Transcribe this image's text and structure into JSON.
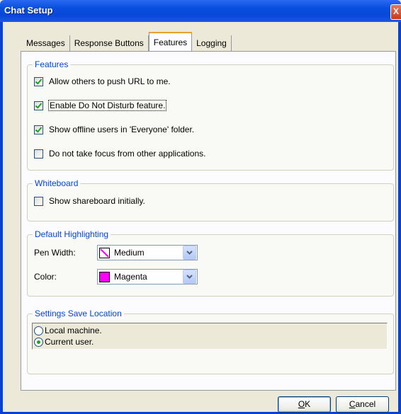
{
  "window": {
    "title": "Chat Setup",
    "close_glyph": "X"
  },
  "tabs": [
    {
      "label": "Messages"
    },
    {
      "label": "Response Buttons"
    },
    {
      "label": "Features",
      "active": true
    },
    {
      "label": "Logging"
    }
  ],
  "features": {
    "legend": "Features",
    "items": [
      {
        "label": "Allow others to push URL to me.",
        "checked": true
      },
      {
        "label": "Enable Do Not Disturb feature.",
        "checked": true
      },
      {
        "label": "Show offline users in 'Everyone' folder.",
        "checked": true
      },
      {
        "label": "Do not take focus from other applications.",
        "checked": false
      }
    ]
  },
  "whiteboard": {
    "legend": "Whiteboard",
    "items": [
      {
        "label": "Show shareboard initially.",
        "checked": false
      }
    ]
  },
  "highlighting": {
    "legend": "Default Highlighting",
    "pen_width_label": "Pen Width:",
    "pen_width_value": "Medium",
    "color_label": "Color:",
    "color_value": "Magenta",
    "color_hex": "#ff00ff"
  },
  "save_location": {
    "legend": "Settings Save Location",
    "options": [
      {
        "label": "Local machine.",
        "selected": false
      },
      {
        "label": "Current user.",
        "selected": true
      }
    ]
  },
  "buttons": {
    "ok_mnemonic": "O",
    "ok_rest": "K",
    "cancel_mnemonic": "C",
    "cancel_rest": "ancel"
  }
}
